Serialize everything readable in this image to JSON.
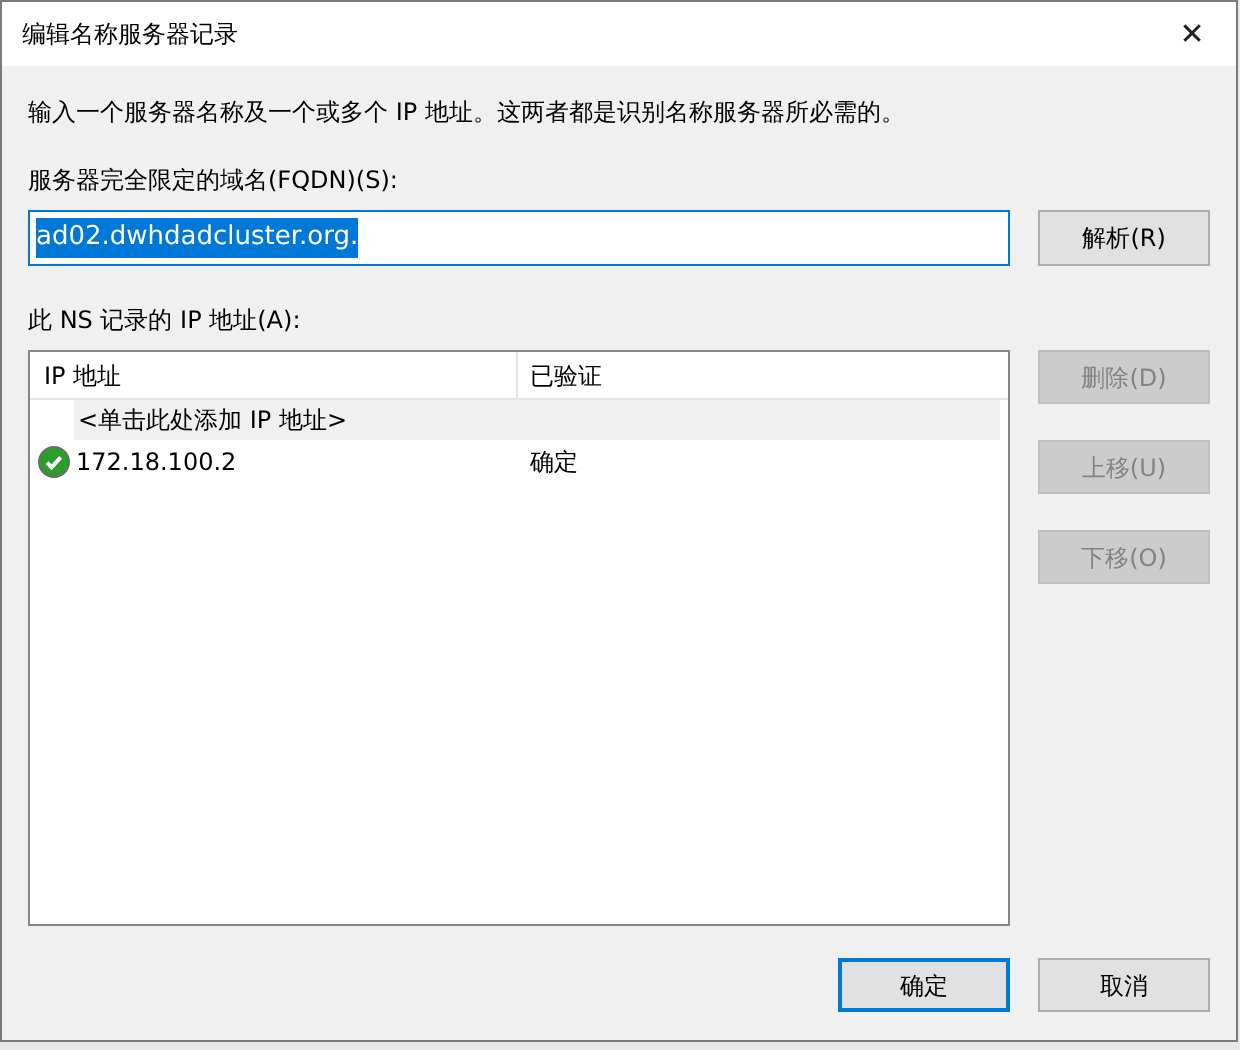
{
  "window": {
    "title": "编辑名称服务器记录",
    "close": "✕"
  },
  "intro": "输入一个服务器名称及一个或多个 IP 地址。这两者都是识别名称服务器所必需的。",
  "fqdn": {
    "label": "服务器完全限定的域名(FQDN)(S):",
    "value": "ad02.dwhdadcluster.org.",
    "selected_text": true
  },
  "resolve_button": "解析(R)",
  "ip_list": {
    "label": "此 NS 记录的 IP 地址(A):",
    "columns": [
      "IP 地址",
      "已验证"
    ],
    "add_hint": "<单击此处添加 IP 地址>",
    "rows": [
      {
        "ip": "172.18.100.2",
        "validated": "确定",
        "ok": true
      }
    ]
  },
  "side_buttons": [
    {
      "label": "删除(D)",
      "disabled": true
    },
    {
      "label": "上移(U)",
      "disabled": true
    },
    {
      "label": "下移(O)",
      "disabled": true
    }
  ],
  "buttons": [
    {
      "label": "确定",
      "default": true
    },
    {
      "label": "取消",
      "default": false
    }
  ]
}
